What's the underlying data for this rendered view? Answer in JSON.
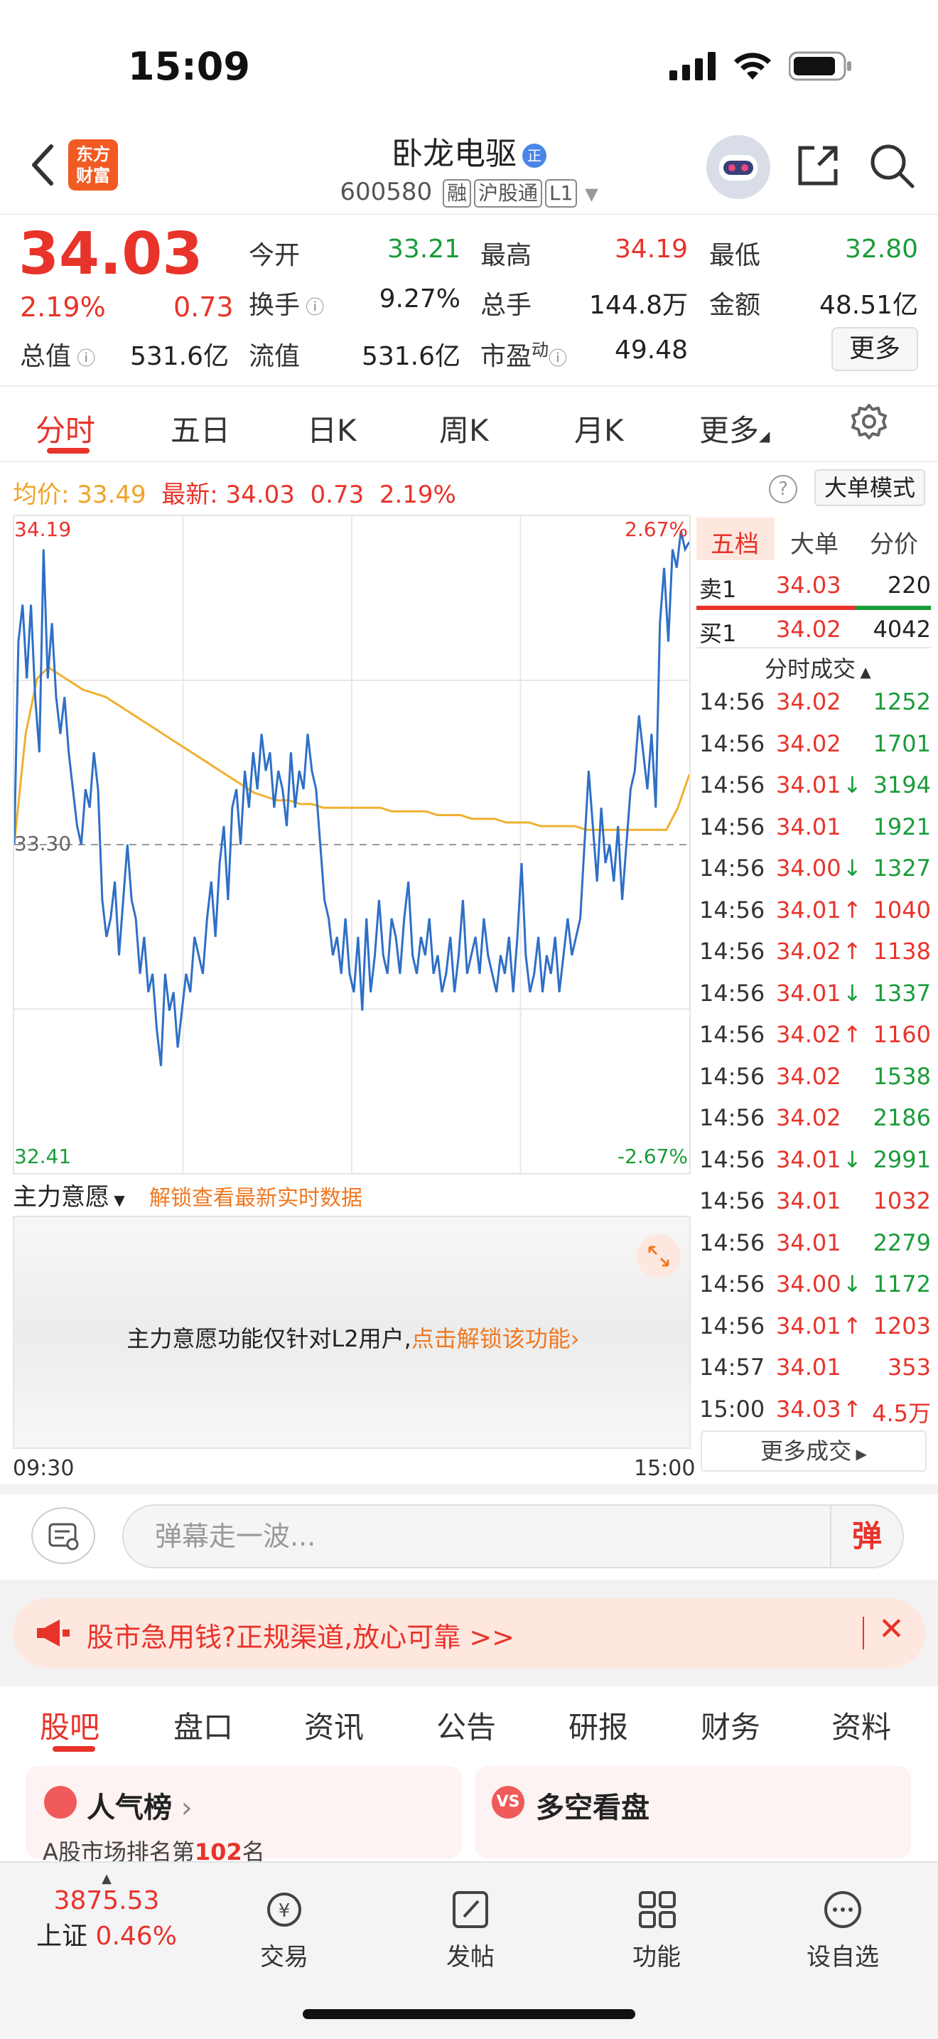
{
  "status_bar": {
    "time": "15:09"
  },
  "header": {
    "logo_line1": "东方",
    "logo_line2": "财富",
    "stock_name": "卧龙电驱",
    "cert_badge": "正",
    "stock_code": "600580",
    "tags": [
      "融",
      "沪股通",
      "L1"
    ]
  },
  "quote": {
    "price": "34.03",
    "change_pct": "2.19%",
    "change_val": "0.73",
    "fields": [
      {
        "label": "今开",
        "value": "33.21",
        "color": "green"
      },
      {
        "label": "最高",
        "value": "34.19",
        "color": "red"
      },
      {
        "label": "最低",
        "value": "32.80",
        "color": "green"
      },
      {
        "label": "换手",
        "value": "9.27%",
        "color": "dark"
      },
      {
        "label": "总手",
        "value": "144.8万",
        "color": "dark"
      },
      {
        "label": "金额",
        "value": "48.51亿",
        "color": "dark"
      },
      {
        "label": "总值",
        "value": "531.6亿",
        "color": "dark"
      },
      {
        "label": "流值",
        "value": "531.6亿",
        "color": "dark"
      },
      {
        "label": "市盈",
        "value": "49.48",
        "color": "dark"
      }
    ],
    "pe_superscript": "动",
    "more_label": "更多"
  },
  "chart_tabs": [
    "分时",
    "五日",
    "日K",
    "周K",
    "月K",
    "更多"
  ],
  "info_row": {
    "avg_label": "均价:",
    "avg_value": "33.49",
    "latest_label": "最新:",
    "latest_value": "34.03",
    "latest_change": "0.73",
    "latest_pct": "2.19%",
    "big_order_label": "大单模式"
  },
  "chart_data": {
    "type": "line",
    "title": "",
    "y_top_label": "34.19",
    "y_mid_label": "33.30",
    "y_bottom_label": "32.41",
    "pct_top_label": "2.67%",
    "pct_bottom_label": "-2.67%",
    "ylim": [
      32.41,
      34.19
    ],
    "reference_price": 33.3,
    "x_start": "09:30",
    "x_end": "15:00",
    "series": [
      {
        "name": "",
        "color": "#2f6fc7",
        "values": [
          33.3,
          33.85,
          33.95,
          33.75,
          33.95,
          33.7,
          33.55,
          34.1,
          33.75,
          33.9,
          33.7,
          33.6,
          33.7,
          33.55,
          33.45,
          33.35,
          33.3,
          33.45,
          33.4,
          33.55,
          33.45,
          33.15,
          33.05,
          33.1,
          33.2,
          33.0,
          33.15,
          33.3,
          33.15,
          33.1,
          32.95,
          33.05,
          32.9,
          32.95,
          32.8,
          32.7,
          32.95,
          32.85,
          32.9,
          32.75,
          32.85,
          32.95,
          32.9,
          33.05,
          33.0,
          32.95,
          33.1,
          33.2,
          33.05,
          33.25,
          33.35,
          33.15,
          33.4,
          33.45,
          33.3,
          33.5,
          33.4,
          33.55,
          33.45,
          33.6,
          33.5,
          33.55,
          33.4,
          33.5,
          33.45,
          33.35,
          33.55,
          33.4,
          33.5,
          33.45,
          33.6,
          33.5,
          33.45,
          33.3,
          33.15,
          33.1,
          33.0,
          33.05,
          32.95,
          33.1,
          32.95,
          32.9,
          33.05,
          32.85,
          33.1,
          32.9,
          33.0,
          33.15,
          33.0,
          32.95,
          33.1,
          33.05,
          32.95,
          33.1,
          33.2,
          33.0,
          32.95,
          33.05,
          33.0,
          33.1,
          32.95,
          33.0,
          32.9,
          32.95,
          33.05,
          32.9,
          33.0,
          33.15,
          32.95,
          33.0,
          33.05,
          32.95,
          33.1,
          33.0,
          32.95,
          32.9,
          33.0,
          32.95,
          33.05,
          32.9,
          33.05,
          33.25,
          33.0,
          32.9,
          32.95,
          33.05,
          32.9,
          33.0,
          32.95,
          33.05,
          32.9,
          33.0,
          33.1,
          33.0,
          33.05,
          33.1,
          33.3,
          33.5,
          33.35,
          33.2,
          33.4,
          33.25,
          33.3,
          33.2,
          33.35,
          33.15,
          33.3,
          33.45,
          33.5,
          33.65,
          33.55,
          33.45,
          33.6,
          33.4,
          33.9,
          34.05,
          33.85,
          34.1,
          34.05,
          34.15,
          34.1,
          34.12
        ]
      },
      {
        "name": "",
        "color": "#f0b030",
        "values": [
          33.3,
          33.6,
          33.75,
          33.78,
          33.76,
          33.74,
          33.72,
          33.71,
          33.7,
          33.68,
          33.66,
          33.64,
          33.62,
          33.6,
          33.58,
          33.56,
          33.54,
          33.52,
          33.5,
          33.48,
          33.46,
          33.44,
          33.43,
          33.42,
          33.42,
          33.41,
          33.41,
          33.4,
          33.4,
          33.4,
          33.4,
          33.4,
          33.4,
          33.39,
          33.39,
          33.39,
          33.39,
          33.38,
          33.38,
          33.38,
          33.37,
          33.37,
          33.37,
          33.36,
          33.36,
          33.36,
          33.35,
          33.35,
          33.35,
          33.35,
          33.34,
          33.34,
          33.34,
          33.34,
          33.34,
          33.34,
          33.34,
          33.34,
          33.4,
          33.49
        ]
      }
    ]
  },
  "order_book": {
    "tabs": [
      "五档",
      "大单",
      "分价"
    ],
    "sell1": {
      "label": "卖1",
      "price": "34.03",
      "vol": "220"
    },
    "buy1": {
      "label": "买1",
      "price": "34.02",
      "vol": "4042"
    },
    "trades_header": "分时成交",
    "trades": [
      {
        "time": "14:56",
        "price": "34.02",
        "arrow": "",
        "vol": "1252",
        "vc": "green"
      },
      {
        "time": "14:56",
        "price": "34.02",
        "arrow": "",
        "vol": "1701",
        "vc": "green"
      },
      {
        "time": "14:56",
        "price": "34.01",
        "arrow": "↓",
        "vol": "3194",
        "vc": "green"
      },
      {
        "time": "14:56",
        "price": "34.01",
        "arrow": "",
        "vol": "1921",
        "vc": "green"
      },
      {
        "time": "14:56",
        "price": "34.00",
        "arrow": "↓",
        "vol": "1327",
        "vc": "green"
      },
      {
        "time": "14:56",
        "price": "34.01",
        "arrow": "↑",
        "vol": "1040",
        "vc": "red"
      },
      {
        "time": "14:56",
        "price": "34.02",
        "arrow": "↑",
        "vol": "1138",
        "vc": "red"
      },
      {
        "time": "14:56",
        "price": "34.01",
        "arrow": "↓",
        "vol": "1337",
        "vc": "green"
      },
      {
        "time": "14:56",
        "price": "34.02",
        "arrow": "↑",
        "vol": "1160",
        "vc": "red"
      },
      {
        "time": "14:56",
        "price": "34.02",
        "arrow": "",
        "vol": "1538",
        "vc": "green"
      },
      {
        "time": "14:56",
        "price": "34.02",
        "arrow": "",
        "vol": "2186",
        "vc": "green"
      },
      {
        "time": "14:56",
        "price": "34.01",
        "arrow": "↓",
        "vol": "2991",
        "vc": "green"
      },
      {
        "time": "14:56",
        "price": "34.01",
        "arrow": "",
        "vol": "1032",
        "vc": "red"
      },
      {
        "time": "14:56",
        "price": "34.01",
        "arrow": "",
        "vol": "2279",
        "vc": "green"
      },
      {
        "time": "14:56",
        "price": "34.00",
        "arrow": "↓",
        "vol": "1172",
        "vc": "green"
      },
      {
        "time": "14:56",
        "price": "34.01",
        "arrow": "↑",
        "vol": "1203",
        "vc": "red"
      },
      {
        "time": "14:57",
        "price": "34.01",
        "arrow": "",
        "vol": "353",
        "vc": "red"
      },
      {
        "time": "15:00",
        "price": "34.03",
        "arrow": "↑",
        "vol": "4.5万",
        "vc": "red"
      }
    ],
    "more_trades": "更多成交"
  },
  "main_force": {
    "label": "主力意愿",
    "unlock_text": "解锁查看最新实时数据",
    "notice": "主力意愿功能仅针对L2用户,",
    "notice_link": "点击解锁该功能"
  },
  "danmaku": {
    "placeholder": "弹幕走一波...",
    "send": "弹"
  },
  "ad": {
    "text": "股市急用钱?正规渠道,放心可靠 >>"
  },
  "content_tabs": [
    "股吧",
    "盘口",
    "资讯",
    "公告",
    "研报",
    "财务",
    "资料"
  ],
  "cards": {
    "popularity_title": "人气榜",
    "popularity_sub_prefix": "A股市场排名第",
    "popularity_rank": "102",
    "popularity_sub_suffix": "名",
    "longshort_title": "多空看盘"
  },
  "bottom_nav": {
    "index_value": "3875.53",
    "index_name": "上证",
    "index_pct": "0.46%",
    "items": [
      "交易",
      "发帖",
      "功能",
      "设自选"
    ]
  }
}
